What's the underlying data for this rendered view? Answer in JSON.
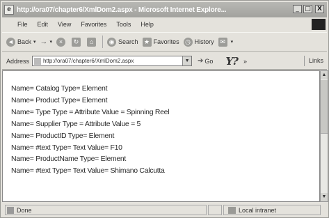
{
  "window": {
    "title": "http://ora07/chapter6/XmlDom2.aspx - Microsoft Internet Explore...",
    "min_symbol": "_",
    "max_symbol": "□",
    "close_symbol": "X"
  },
  "menu": {
    "items": [
      "File",
      "Edit",
      "View",
      "Favorites",
      "Tools",
      "Help"
    ]
  },
  "toolbar": {
    "back_label": "Back",
    "search_label": "Search",
    "favorites_label": "Favorites",
    "history_label": "History"
  },
  "address": {
    "label": "Address",
    "url": "http://ora07/chapter6/XmlDom2.aspx",
    "go_label": "Go",
    "links_label": "Links"
  },
  "content": {
    "lines": [
      "Name= Catalog Type= Element",
      "Name= Product Type= Element",
      "Name= Type Type = Attribute Value = Spinning Reel",
      "Name= Supplier Type = Attribute Value = 5",
      "Name= ProductID Type= Element",
      "Name= #text Type= Text Value= F10",
      "Name= ProductName Type= Element",
      "Name= #text Type= Text Value= Shimano Calcutta"
    ]
  },
  "status": {
    "done_label": "Done",
    "zone_label": "Local intranet"
  },
  "icons": {
    "page": "page-icon",
    "back": "back-arrow-icon",
    "forward": "forward-arrow-icon",
    "stop": "stop-icon",
    "refresh": "refresh-icon",
    "home": "home-icon",
    "search": "search-icon",
    "favorites": "favorites-icon",
    "history": "history-icon",
    "zone": "intranet-zone-icon"
  }
}
